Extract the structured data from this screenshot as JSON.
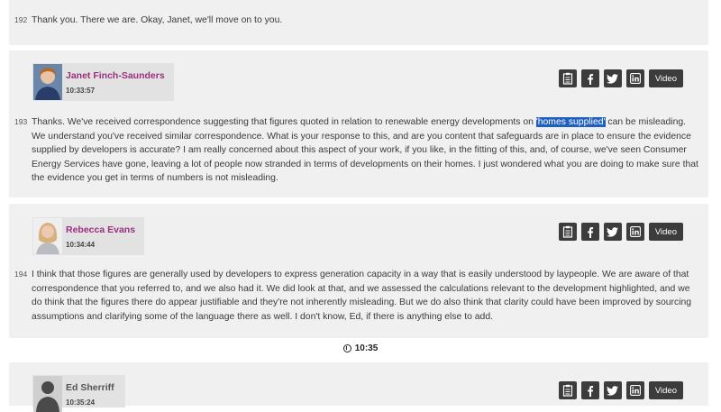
{
  "entries": [
    {
      "num": "192",
      "text": "Thank you. There we are. Okay, Janet, we'll move on to you."
    },
    {
      "num": "193",
      "speaker": {
        "name": "Janet Finch-Saunders",
        "time": "10:33:57"
      },
      "text_before": "Thanks. We've received correspondence suggesting that figures quoted in relation to renewable energy developments on ",
      "text_highlight": "'homes supplied'",
      "text_after": " can be misleading. We understand you've received similar correspondence. What is your response to this, and are you content that safeguards are in place to ensure the evidence supplied by developers is accurate? I am really concerned about this aspect of your work, if you like, in the fitting of this, and, of course, we've seen Consumer Energy Services have gone, leaving a lot of people now stranded in terms of developments on their homes. I just wondered what you are doing to make sure that the evidence you get in terms of numbers is not misleading."
    },
    {
      "num": "194",
      "speaker": {
        "name": "Rebecca Evans",
        "time": "10:34:44"
      },
      "text": "I think that those figures are generally used by developers to express generation capacity in a way that is easily understood by laypeople. We are aware of that correspondence that you referred to, and we also had it. We did look at that, and we assessed the calculations relevant to the development highlighted, and we do think that the figures there do appear justifiable and they're not inherently misleading. But we do also think that clarity could have been improved by sourcing assumptions and clarifying some of the language there as well. I don't know, Ed, if there is anything else to add."
    },
    {
      "speaker": {
        "name": "Ed Sherriff",
        "time": "10:35:24"
      }
    }
  ],
  "time_marker": "10:35",
  "share": {
    "video_label": "Video",
    "icons": [
      "clipboard-icon",
      "facebook-icon",
      "twitter-icon",
      "linkedin-icon"
    ]
  },
  "colors": {
    "speaker_name": "#9b2f7f",
    "button_bg": "#3c3c3c",
    "highlight": "#1f5fbf"
  }
}
